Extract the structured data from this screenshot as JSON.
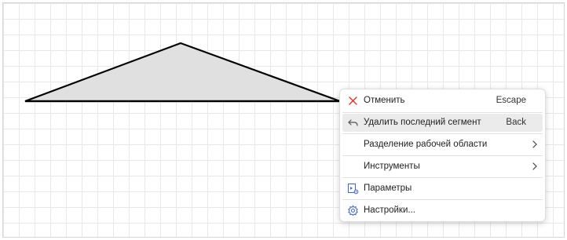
{
  "menu": {
    "items": [
      {
        "label": "Отменить",
        "shortcut": "Escape",
        "icon": "close-icon",
        "color": "#d9342b"
      },
      {
        "label": "Удалить последний сегмент",
        "shortcut": "Back",
        "icon": "undo-icon",
        "highlighted": true
      },
      {
        "label": "Разделение рабочей области",
        "submenu": true
      },
      {
        "label": "Инструменты",
        "submenu": true
      },
      {
        "label": "Параметры",
        "icon": "parameters-icon",
        "color": "#4a6cb0"
      },
      {
        "label": "Настройки...",
        "icon": "gear-icon",
        "color": "#4a6cb0"
      }
    ]
  },
  "canvas": {
    "shape_fill": "#e0e0e0",
    "shape_stroke": "#000000"
  }
}
